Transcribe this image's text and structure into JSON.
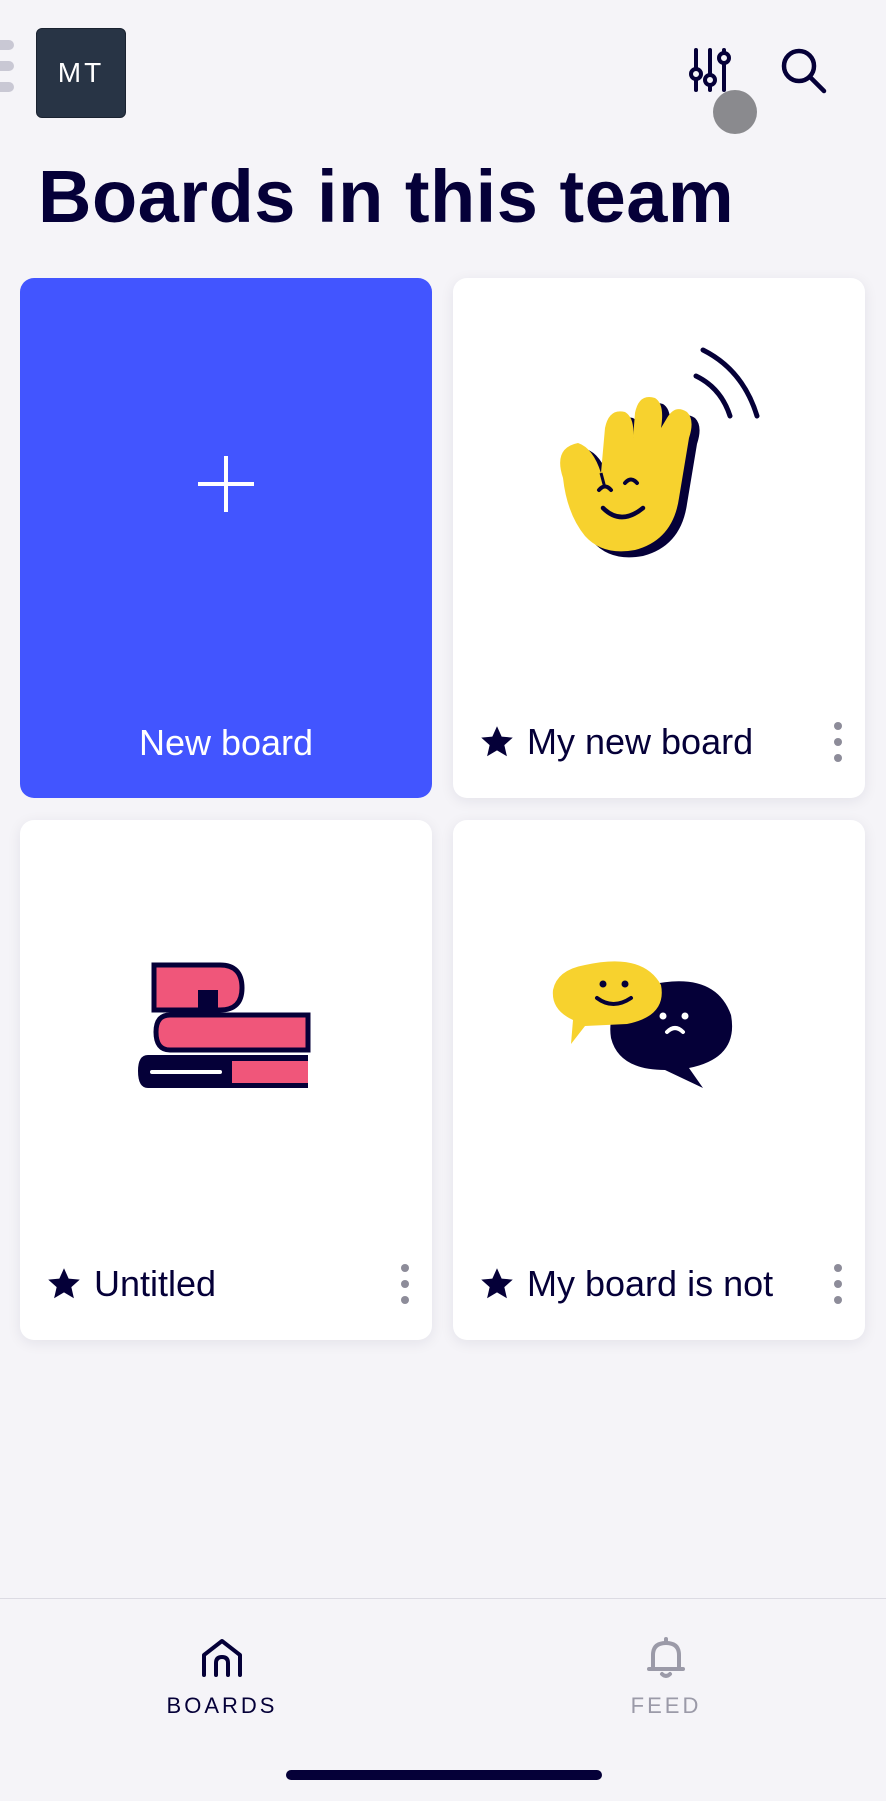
{
  "header": {
    "avatar_initials": "MT",
    "filter_icon": "sliders-icon",
    "search_icon": "search-icon"
  },
  "page": {
    "title": "Boards in this team"
  },
  "new_board": {
    "label": "New board",
    "icon": "plus-icon",
    "color": "#4255ff"
  },
  "boards": [
    {
      "name": "My new board",
      "icon": "waving-hand-icon",
      "starred": true
    },
    {
      "name": "Untitled",
      "icon": "books-icon",
      "starred": true
    },
    {
      "name": "My board is not",
      "icon": "speech-bubbles-icon",
      "starred": true
    }
  ],
  "tabbar": {
    "boards": {
      "label": "BOARDS",
      "icon": "home-icon",
      "active": true
    },
    "feed": {
      "label": "FEED",
      "icon": "bell-icon",
      "active": false
    }
  },
  "colors": {
    "accent": "#4255ff",
    "ink": "#050038",
    "yellow": "#f7d22e",
    "pink": "#f0567a",
    "background": "#f5f4f8"
  }
}
